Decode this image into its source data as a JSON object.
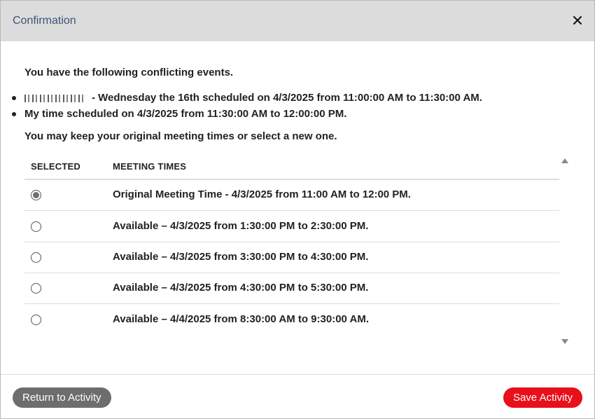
{
  "dialog": {
    "title": "Confirmation",
    "close_icon": "close-icon"
  },
  "content": {
    "intro": "You have the following conflicting events.",
    "conflicts": [
      {
        "redacted": true,
        "text": "- Wednesday the 16th scheduled on 4/3/2025 from 11:00:00 AM to 11:30:00 AM."
      },
      {
        "redacted": false,
        "text": "My time scheduled on 4/3/2025 from 11:30:00 AM to 12:00:00 PM."
      }
    ],
    "note": "You may keep your original meeting times or select a new one."
  },
  "table": {
    "headers": {
      "selected": "SELECTED",
      "meeting_times": "MEETING TIMES"
    },
    "rows": [
      {
        "label": "Original Meeting Time - 4/3/2025 from 11:00 AM to 12:00 PM.",
        "selected": true
      },
      {
        "label": "Available – 4/3/2025 from 1:30:00 PM to 2:30:00 PM.",
        "selected": false
      },
      {
        "label": "Available – 4/3/2025 from 3:30:00 PM to 4:30:00 PM.",
        "selected": false
      },
      {
        "label": "Available – 4/3/2025 from 4:30:00 PM to 5:30:00 PM.",
        "selected": false
      },
      {
        "label": "Available – 4/4/2025 from 8:30:00 AM to 9:30:00 AM.",
        "selected": false
      }
    ]
  },
  "footer": {
    "return_label": "Return to Activity",
    "save_label": "Save Activity"
  },
  "colors": {
    "header_bg": "#dcdcdc",
    "title_text": "#3b5577",
    "save_button": "#e8101a",
    "return_button": "#6d6d6d"
  }
}
